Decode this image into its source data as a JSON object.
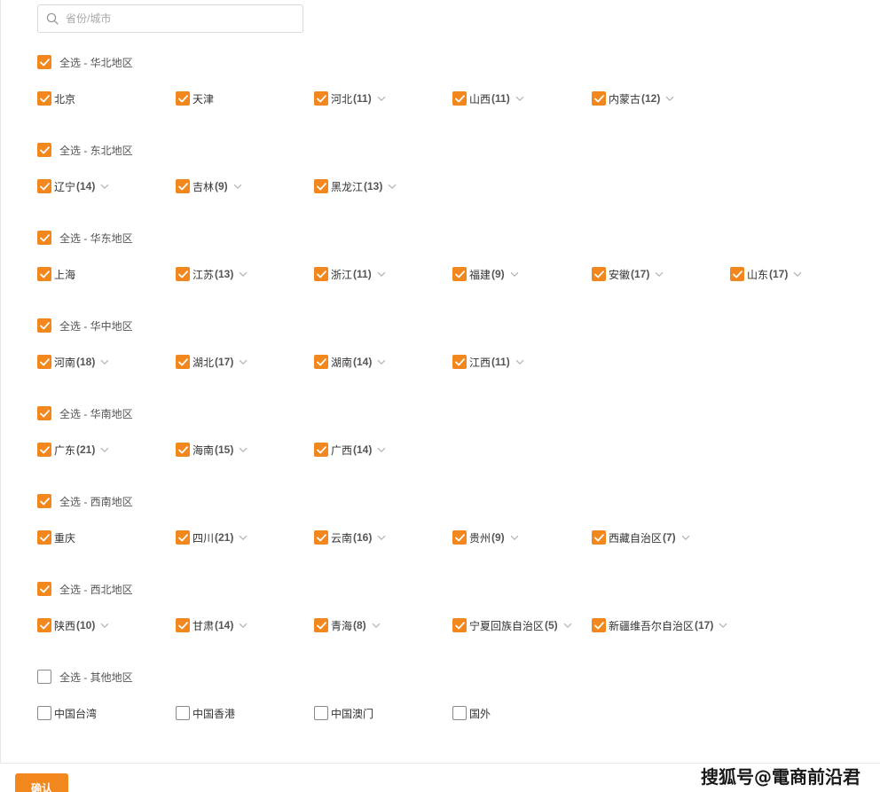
{
  "search": {
    "placeholder": "省份/城市"
  },
  "regions": [
    {
      "select_all": "全选 - 华北地区",
      "checked": true,
      "provinces": [
        {
          "name": "北京",
          "count": "",
          "checked": true,
          "expandable": false
        },
        {
          "name": "天津",
          "count": "",
          "checked": true,
          "expandable": false
        },
        {
          "name": "河北",
          "count": "(11)",
          "checked": true,
          "expandable": true
        },
        {
          "name": "山西",
          "count": "(11)",
          "checked": true,
          "expandable": true
        },
        {
          "name": "内蒙古",
          "count": "(12)",
          "checked": true,
          "expandable": true
        }
      ]
    },
    {
      "select_all": "全选 - 东北地区",
      "checked": true,
      "provinces": [
        {
          "name": "辽宁",
          "count": "(14)",
          "checked": true,
          "expandable": true
        },
        {
          "name": "吉林",
          "count": "(9)",
          "checked": true,
          "expandable": true
        },
        {
          "name": "黑龙江",
          "count": "(13)",
          "checked": true,
          "expandable": true
        }
      ]
    },
    {
      "select_all": "全选 - 华东地区",
      "checked": true,
      "provinces": [
        {
          "name": "上海",
          "count": "",
          "checked": true,
          "expandable": false
        },
        {
          "name": "江苏",
          "count": "(13)",
          "checked": true,
          "expandable": true
        },
        {
          "name": "浙江",
          "count": "(11)",
          "checked": true,
          "expandable": true
        },
        {
          "name": "福建",
          "count": "(9)",
          "checked": true,
          "expandable": true
        },
        {
          "name": "安徽",
          "count": "(17)",
          "checked": true,
          "expandable": true
        },
        {
          "name": "山东",
          "count": "(17)",
          "checked": true,
          "expandable": true
        }
      ]
    },
    {
      "select_all": "全选 - 华中地区",
      "checked": true,
      "provinces": [
        {
          "name": "河南",
          "count": "(18)",
          "checked": true,
          "expandable": true
        },
        {
          "name": "湖北",
          "count": "(17)",
          "checked": true,
          "expandable": true
        },
        {
          "name": "湖南",
          "count": "(14)",
          "checked": true,
          "expandable": true
        },
        {
          "name": "江西",
          "count": "(11)",
          "checked": true,
          "expandable": true
        }
      ]
    },
    {
      "select_all": "全选 - 华南地区",
      "checked": true,
      "provinces": [
        {
          "name": "广东",
          "count": "(21)",
          "checked": true,
          "expandable": true
        },
        {
          "name": "海南",
          "count": "(15)",
          "checked": true,
          "expandable": true
        },
        {
          "name": "广西",
          "count": "(14)",
          "checked": true,
          "expandable": true
        }
      ]
    },
    {
      "select_all": "全选 - 西南地区",
      "checked": true,
      "provinces": [
        {
          "name": "重庆",
          "count": "",
          "checked": true,
          "expandable": false
        },
        {
          "name": "四川",
          "count": "(21)",
          "checked": true,
          "expandable": true
        },
        {
          "name": "云南",
          "count": "(16)",
          "checked": true,
          "expandable": true
        },
        {
          "name": "贵州",
          "count": "(9)",
          "checked": true,
          "expandable": true
        },
        {
          "name": "西藏自治区",
          "count": "(7)",
          "checked": true,
          "expandable": true
        }
      ]
    },
    {
      "select_all": "全选 - 西北地区",
      "checked": true,
      "provinces": [
        {
          "name": "陕西",
          "count": "(10)",
          "checked": true,
          "expandable": true
        },
        {
          "name": "甘肃",
          "count": "(14)",
          "checked": true,
          "expandable": true
        },
        {
          "name": "青海",
          "count": "(8)",
          "checked": true,
          "expandable": true
        },
        {
          "name": "宁夏回族自治区",
          "count": "(5)",
          "checked": true,
          "expandable": true
        },
        {
          "name": "新疆维吾尔自治区",
          "count": "(17)",
          "checked": true,
          "expandable": true
        }
      ]
    },
    {
      "select_all": "全选 - 其他地区",
      "checked": false,
      "provinces": [
        {
          "name": "中国台湾",
          "count": "",
          "checked": false,
          "expandable": false
        },
        {
          "name": "中国香港",
          "count": "",
          "checked": false,
          "expandable": false
        },
        {
          "name": "中国澳门",
          "count": "",
          "checked": false,
          "expandable": false
        },
        {
          "name": "国外",
          "count": "",
          "checked": false,
          "expandable": false
        }
      ]
    }
  ],
  "footer": {
    "confirm_label": "确认"
  },
  "watermark": "搜狐号@電商前沿君",
  "colors": {
    "accent": "#f2871e",
    "border": "#d9d9d9",
    "chevron": "#b3b3b3"
  }
}
